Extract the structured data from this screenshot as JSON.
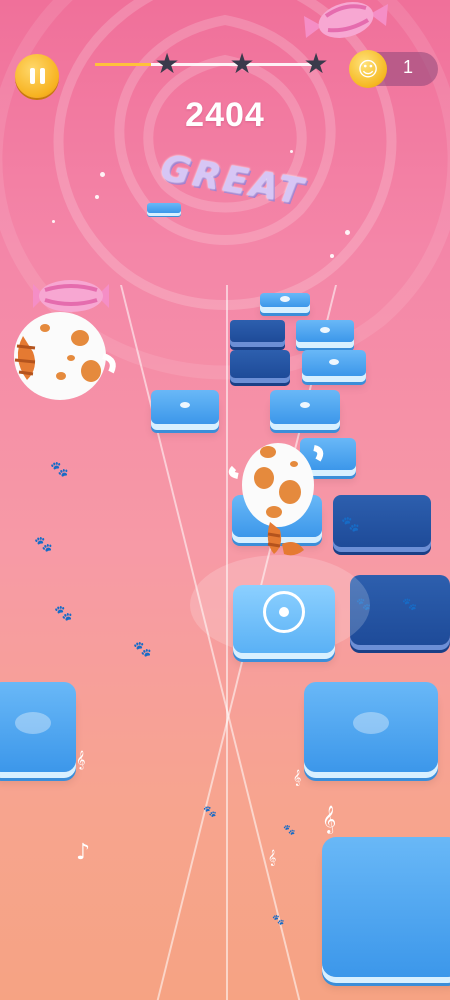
{
  "hud": {
    "pause_icon": "pause-icon",
    "score": "2404",
    "stars_collected": 0,
    "stars_total": 3,
    "level_progress": 0.25,
    "coin_icon": "coin-icon",
    "coins": "1"
  },
  "feedback_text": "GREAT",
  "colors": {
    "tile_light": "#4aa6f0",
    "tile_dark": "#1e4b99",
    "accent_gold": "#f7b21f",
    "star_empty": "#3a3a4c"
  },
  "characters": [
    {
      "name": "player-cat-ball",
      "icon": "cat-ball-icon"
    },
    {
      "name": "candy-cat-ball",
      "icon": "cat-ball-icon"
    }
  ]
}
